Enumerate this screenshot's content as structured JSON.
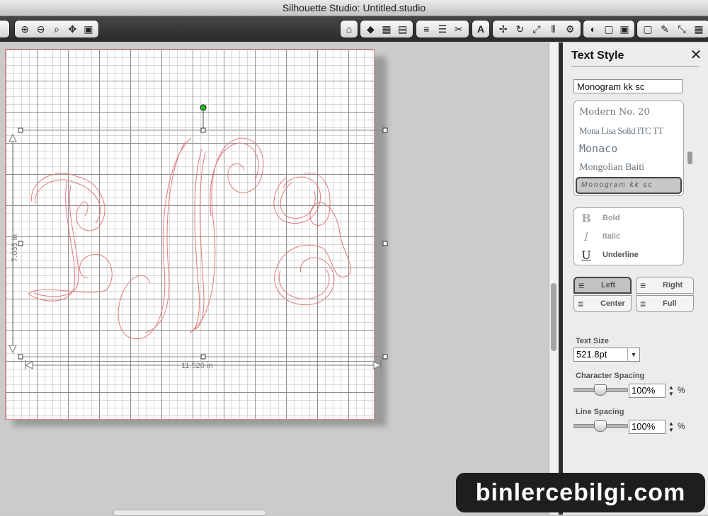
{
  "window": {
    "title": "Silhouette Studio: Untitled.studio"
  },
  "toolbar": {
    "left_group": [
      "zoom-in-icon",
      "zoom-out-icon",
      "zoom-select-icon",
      "pan-icon",
      "fit-page-icon"
    ],
    "glyphs": {
      "zoom_in": "⊕",
      "zoom_out": "⊖",
      "zoom_sel": "⌕",
      "pan": "✥",
      "fit": "▣",
      "home": "⌂",
      "fill": "◆",
      "grid1": "▦",
      "grid2": "▤",
      "line": "≡",
      "line2": "☰",
      "scissors": "✂",
      "text": "A",
      "move": "✢",
      "rotate": "↻",
      "scale": "⤢",
      "align": "⫴",
      "replicate": "⚙",
      "a1": "◐",
      "a2": "▢",
      "a3": "▣",
      "a4": "▢",
      "pen": "✎",
      "expand": "⤡",
      "gridview": "▦"
    }
  },
  "canvas": {
    "monogram_letters": [
      "L",
      "N",
      "B"
    ],
    "height_dim": "7.035 in",
    "width_dim": "11.520 in"
  },
  "panel": {
    "title": "Text Style",
    "font_input": "Monogram kk sc",
    "fonts": [
      "Modern No. 20",
      "Mona Lisa Solid ITC TT",
      "Monaco",
      "Mongolian Baiti",
      "Monogram kk sc"
    ],
    "styles": [
      {
        "glyph": "B",
        "label": "Bold"
      },
      {
        "glyph": "I",
        "label": "Italic"
      },
      {
        "glyph": "U",
        "label": "Underline"
      }
    ],
    "align": {
      "left": "Left",
      "right": "Right",
      "center": "Center",
      "full": "Full",
      "icon": "≡"
    },
    "text_size_label": "Text Size",
    "text_size": "521.8pt",
    "char_spacing_label": "Character Spacing",
    "char_spacing": "100%",
    "line_spacing_label": "Line Spacing",
    "line_spacing": "100%",
    "unit": "%",
    "stepper": "▲\n▼"
  },
  "watermark": "binlercebilgi.com",
  "colors": {
    "outline": "#e07a7a",
    "handle_green": "#1fbf1f"
  }
}
